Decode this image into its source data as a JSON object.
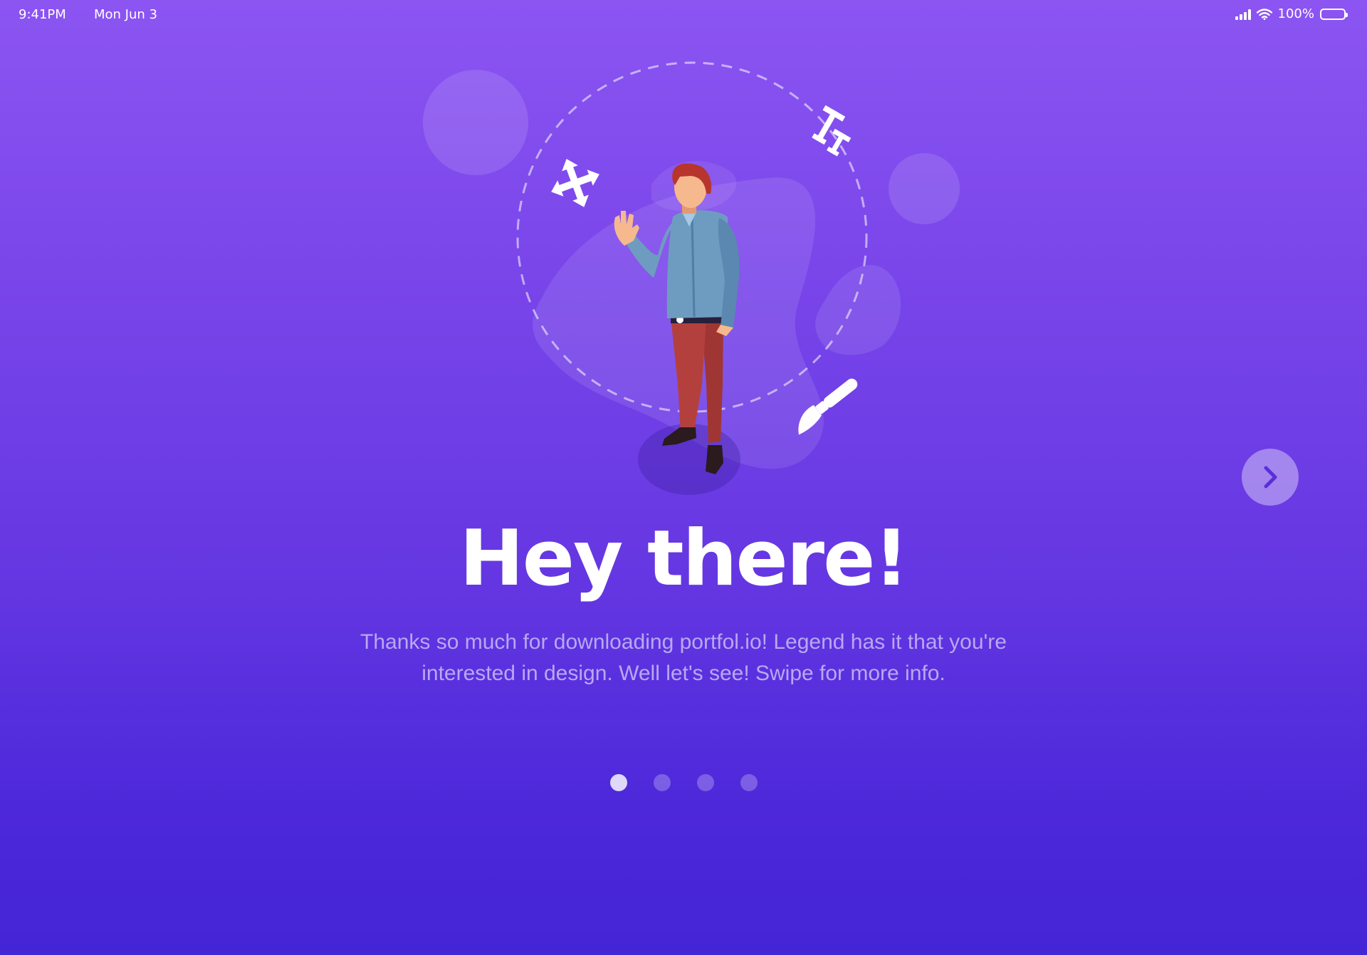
{
  "status_bar": {
    "time": "9:41PM",
    "date": "Mon Jun 3",
    "battery": "100%",
    "icons": [
      "signal-icon",
      "wifi-icon",
      "battery-icon"
    ]
  },
  "onboarding": {
    "title": "Hey there!",
    "subtitle": "Thanks so much for downloading portfol.io! Legend has it that you're interested in design. Well let's see! Swipe for more info.",
    "next_icon": "chevron-right-icon",
    "illustration_icons": [
      "move-arrows-icon",
      "text-size-icon",
      "paintbrush-icon"
    ],
    "pager": {
      "total": 4,
      "active_index": 0
    }
  },
  "colors": {
    "gradient_top": "#8c55f2",
    "gradient_bottom": "#4425d6",
    "subtitle": "#b9a8f2",
    "shirt": "#6e9cc0",
    "pants": "#b4403e",
    "hair": "#b8352e",
    "skin": "#f6b98e"
  }
}
